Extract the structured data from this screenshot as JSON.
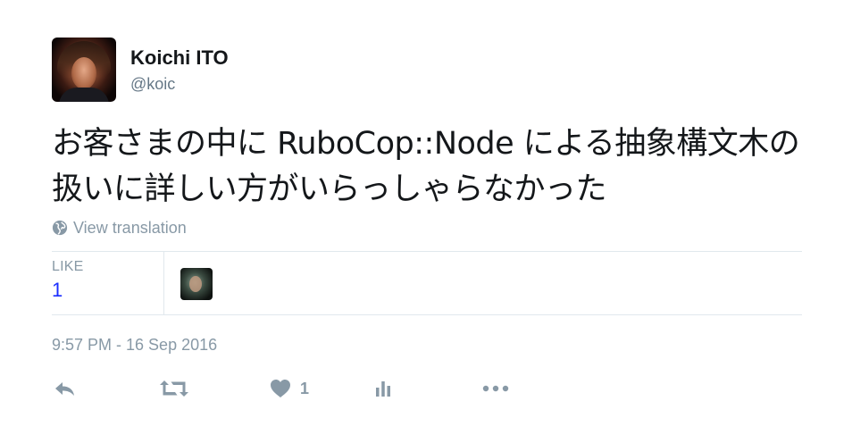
{
  "author": {
    "display_name": "Koichi ITO",
    "screen_name": "@koic"
  },
  "tweet": {
    "text": "お客さまの中に RuboCop::Node による抽象構文木の扱いに詳しい方がいらっしゃらなかった"
  },
  "translate": {
    "label": "View translation",
    "icon": "globe-icon"
  },
  "stats": {
    "likes_label": "LIKE",
    "likes_value": "1"
  },
  "timestamp": "9:57 PM - 16 Sep 2016",
  "actions": {
    "reply_icon": "reply-icon",
    "retweet_icon": "retweet-icon",
    "like_icon": "heart-icon",
    "like_count": "1",
    "analytics_icon": "analytics-icon",
    "more_icon": "more-icon"
  },
  "colors": {
    "text": "#14171a",
    "muted": "#8899a6",
    "link": "#1b2fff",
    "border": "#e1e8ed"
  }
}
